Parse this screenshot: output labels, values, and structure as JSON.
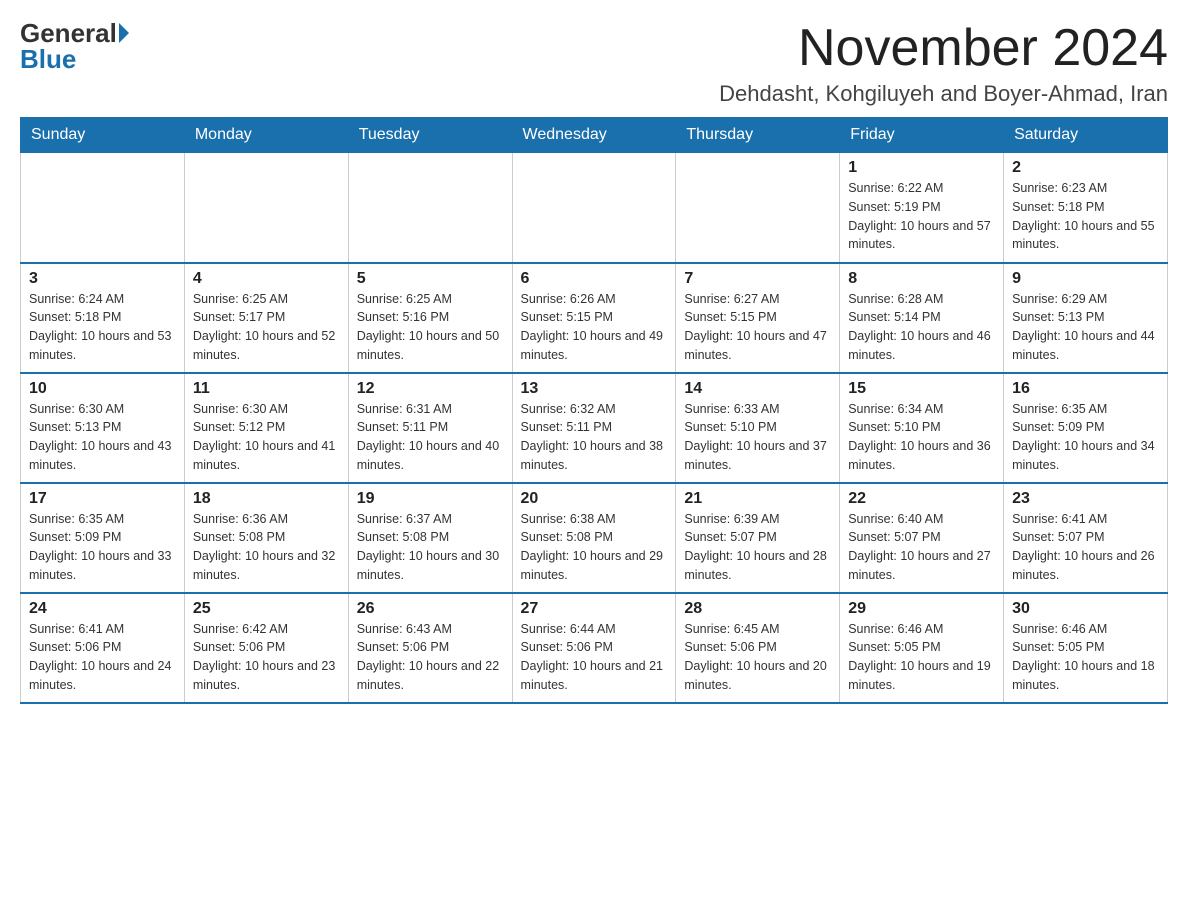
{
  "logo": {
    "general": "General",
    "blue": "Blue"
  },
  "title": "November 2024",
  "location": "Dehdasht, Kohgiluyeh and Boyer-Ahmad, Iran",
  "days_of_week": [
    "Sunday",
    "Monday",
    "Tuesday",
    "Wednesday",
    "Thursday",
    "Friday",
    "Saturday"
  ],
  "weeks": [
    [
      {
        "day": "",
        "sunrise": "",
        "sunset": "",
        "daylight": ""
      },
      {
        "day": "",
        "sunrise": "",
        "sunset": "",
        "daylight": ""
      },
      {
        "day": "",
        "sunrise": "",
        "sunset": "",
        "daylight": ""
      },
      {
        "day": "",
        "sunrise": "",
        "sunset": "",
        "daylight": ""
      },
      {
        "day": "",
        "sunrise": "",
        "sunset": "",
        "daylight": ""
      },
      {
        "day": "1",
        "sunrise": "Sunrise: 6:22 AM",
        "sunset": "Sunset: 5:19 PM",
        "daylight": "Daylight: 10 hours and 57 minutes."
      },
      {
        "day": "2",
        "sunrise": "Sunrise: 6:23 AM",
        "sunset": "Sunset: 5:18 PM",
        "daylight": "Daylight: 10 hours and 55 minutes."
      }
    ],
    [
      {
        "day": "3",
        "sunrise": "Sunrise: 6:24 AM",
        "sunset": "Sunset: 5:18 PM",
        "daylight": "Daylight: 10 hours and 53 minutes."
      },
      {
        "day": "4",
        "sunrise": "Sunrise: 6:25 AM",
        "sunset": "Sunset: 5:17 PM",
        "daylight": "Daylight: 10 hours and 52 minutes."
      },
      {
        "day": "5",
        "sunrise": "Sunrise: 6:25 AM",
        "sunset": "Sunset: 5:16 PM",
        "daylight": "Daylight: 10 hours and 50 minutes."
      },
      {
        "day": "6",
        "sunrise": "Sunrise: 6:26 AM",
        "sunset": "Sunset: 5:15 PM",
        "daylight": "Daylight: 10 hours and 49 minutes."
      },
      {
        "day": "7",
        "sunrise": "Sunrise: 6:27 AM",
        "sunset": "Sunset: 5:15 PM",
        "daylight": "Daylight: 10 hours and 47 minutes."
      },
      {
        "day": "8",
        "sunrise": "Sunrise: 6:28 AM",
        "sunset": "Sunset: 5:14 PM",
        "daylight": "Daylight: 10 hours and 46 minutes."
      },
      {
        "day": "9",
        "sunrise": "Sunrise: 6:29 AM",
        "sunset": "Sunset: 5:13 PM",
        "daylight": "Daylight: 10 hours and 44 minutes."
      }
    ],
    [
      {
        "day": "10",
        "sunrise": "Sunrise: 6:30 AM",
        "sunset": "Sunset: 5:13 PM",
        "daylight": "Daylight: 10 hours and 43 minutes."
      },
      {
        "day": "11",
        "sunrise": "Sunrise: 6:30 AM",
        "sunset": "Sunset: 5:12 PM",
        "daylight": "Daylight: 10 hours and 41 minutes."
      },
      {
        "day": "12",
        "sunrise": "Sunrise: 6:31 AM",
        "sunset": "Sunset: 5:11 PM",
        "daylight": "Daylight: 10 hours and 40 minutes."
      },
      {
        "day": "13",
        "sunrise": "Sunrise: 6:32 AM",
        "sunset": "Sunset: 5:11 PM",
        "daylight": "Daylight: 10 hours and 38 minutes."
      },
      {
        "day": "14",
        "sunrise": "Sunrise: 6:33 AM",
        "sunset": "Sunset: 5:10 PM",
        "daylight": "Daylight: 10 hours and 37 minutes."
      },
      {
        "day": "15",
        "sunrise": "Sunrise: 6:34 AM",
        "sunset": "Sunset: 5:10 PM",
        "daylight": "Daylight: 10 hours and 36 minutes."
      },
      {
        "day": "16",
        "sunrise": "Sunrise: 6:35 AM",
        "sunset": "Sunset: 5:09 PM",
        "daylight": "Daylight: 10 hours and 34 minutes."
      }
    ],
    [
      {
        "day": "17",
        "sunrise": "Sunrise: 6:35 AM",
        "sunset": "Sunset: 5:09 PM",
        "daylight": "Daylight: 10 hours and 33 minutes."
      },
      {
        "day": "18",
        "sunrise": "Sunrise: 6:36 AM",
        "sunset": "Sunset: 5:08 PM",
        "daylight": "Daylight: 10 hours and 32 minutes."
      },
      {
        "day": "19",
        "sunrise": "Sunrise: 6:37 AM",
        "sunset": "Sunset: 5:08 PM",
        "daylight": "Daylight: 10 hours and 30 minutes."
      },
      {
        "day": "20",
        "sunrise": "Sunrise: 6:38 AM",
        "sunset": "Sunset: 5:08 PM",
        "daylight": "Daylight: 10 hours and 29 minutes."
      },
      {
        "day": "21",
        "sunrise": "Sunrise: 6:39 AM",
        "sunset": "Sunset: 5:07 PM",
        "daylight": "Daylight: 10 hours and 28 minutes."
      },
      {
        "day": "22",
        "sunrise": "Sunrise: 6:40 AM",
        "sunset": "Sunset: 5:07 PM",
        "daylight": "Daylight: 10 hours and 27 minutes."
      },
      {
        "day": "23",
        "sunrise": "Sunrise: 6:41 AM",
        "sunset": "Sunset: 5:07 PM",
        "daylight": "Daylight: 10 hours and 26 minutes."
      }
    ],
    [
      {
        "day": "24",
        "sunrise": "Sunrise: 6:41 AM",
        "sunset": "Sunset: 5:06 PM",
        "daylight": "Daylight: 10 hours and 24 minutes."
      },
      {
        "day": "25",
        "sunrise": "Sunrise: 6:42 AM",
        "sunset": "Sunset: 5:06 PM",
        "daylight": "Daylight: 10 hours and 23 minutes."
      },
      {
        "day": "26",
        "sunrise": "Sunrise: 6:43 AM",
        "sunset": "Sunset: 5:06 PM",
        "daylight": "Daylight: 10 hours and 22 minutes."
      },
      {
        "day": "27",
        "sunrise": "Sunrise: 6:44 AM",
        "sunset": "Sunset: 5:06 PM",
        "daylight": "Daylight: 10 hours and 21 minutes."
      },
      {
        "day": "28",
        "sunrise": "Sunrise: 6:45 AM",
        "sunset": "Sunset: 5:06 PM",
        "daylight": "Daylight: 10 hours and 20 minutes."
      },
      {
        "day": "29",
        "sunrise": "Sunrise: 6:46 AM",
        "sunset": "Sunset: 5:05 PM",
        "daylight": "Daylight: 10 hours and 19 minutes."
      },
      {
        "day": "30",
        "sunrise": "Sunrise: 6:46 AM",
        "sunset": "Sunset: 5:05 PM",
        "daylight": "Daylight: 10 hours and 18 minutes."
      }
    ]
  ]
}
